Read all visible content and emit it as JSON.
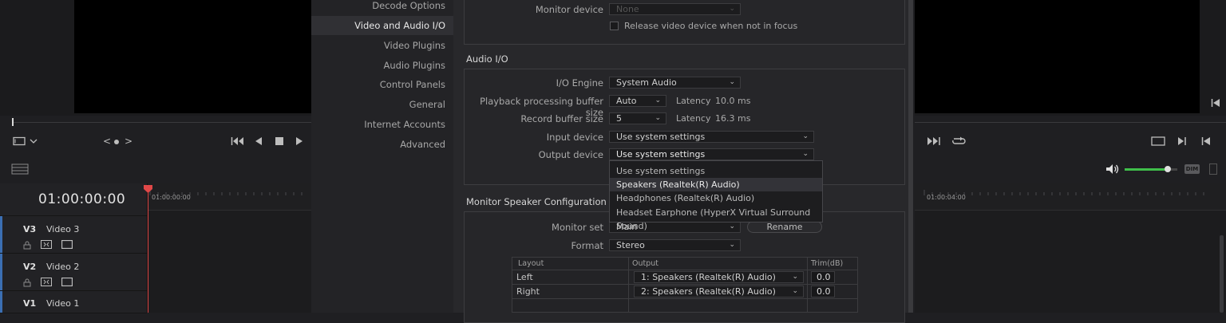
{
  "left_viewer": {
    "nav_prev": "<",
    "nav_next": ">"
  },
  "timeline": {
    "timecode": "01:00:00:00",
    "ruler_start": "01:00:00:00",
    "ruler_right": "01:00:04:00",
    "tracks": [
      {
        "id": "V3",
        "name": "Video 3"
      },
      {
        "id": "V2",
        "name": "Video 2"
      },
      {
        "id": "V1",
        "name": "Video 1"
      }
    ]
  },
  "audio_meter": {
    "dim_label": "DIM",
    "volume_level": 0.82,
    "accent": "#3fbf4a"
  },
  "sidebar": {
    "items": [
      {
        "label": "Decode Options",
        "active": false
      },
      {
        "label": "Video and Audio I/O",
        "active": true
      },
      {
        "label": "Video Plugins",
        "active": false
      },
      {
        "label": "Audio Plugins",
        "active": false
      },
      {
        "label": "Control Panels",
        "active": false
      },
      {
        "label": "General",
        "active": false
      },
      {
        "label": "Internet Accounts",
        "active": false
      },
      {
        "label": "Advanced",
        "active": false
      }
    ]
  },
  "video_io": {
    "monitor_device_label": "Monitor device",
    "monitor_device_value": "None",
    "release_label": "Release video device when not in focus"
  },
  "audio_io": {
    "title": "Audio I/O",
    "io_engine_label": "I/O Engine",
    "io_engine_value": "System Audio",
    "playback_label": "Playback processing buffer size",
    "playback_value": "Auto",
    "latency_label": "Latency",
    "playback_latency": "10.0 ms",
    "record_label": "Record buffer size",
    "record_value": "5",
    "record_latency": "16.3 ms",
    "input_label": "Input device",
    "input_value": "Use system settings",
    "output_label": "Output device",
    "output_value": "Use system settings"
  },
  "output_dropdown": {
    "options": [
      {
        "label": "Use system settings",
        "highlighted": false
      },
      {
        "label": "Speakers (Realtek(R) Audio)",
        "highlighted": true
      },
      {
        "label": "Headphones (Realtek(R) Audio)",
        "highlighted": false
      },
      {
        "label": "Headset Earphone (HyperX Virtual Surround Sound)",
        "highlighted": false
      }
    ]
  },
  "monitor_speaker": {
    "title": "Monitor Speaker Configuration",
    "monitor_set_label": "Monitor set",
    "monitor_set_value": "Main",
    "rename_label": "Rename",
    "format_label": "Format",
    "format_value": "Stereo",
    "table": {
      "headers": [
        "Layout",
        "Output",
        "Trim(dB)"
      ],
      "rows": [
        {
          "layout": "Left",
          "output": "1: Speakers (Realtek(R) Audio)",
          "trim": "0.0"
        },
        {
          "layout": "Right",
          "output": "2: Speakers (Realtek(R) Audio)",
          "trim": "0.0"
        }
      ]
    }
  }
}
